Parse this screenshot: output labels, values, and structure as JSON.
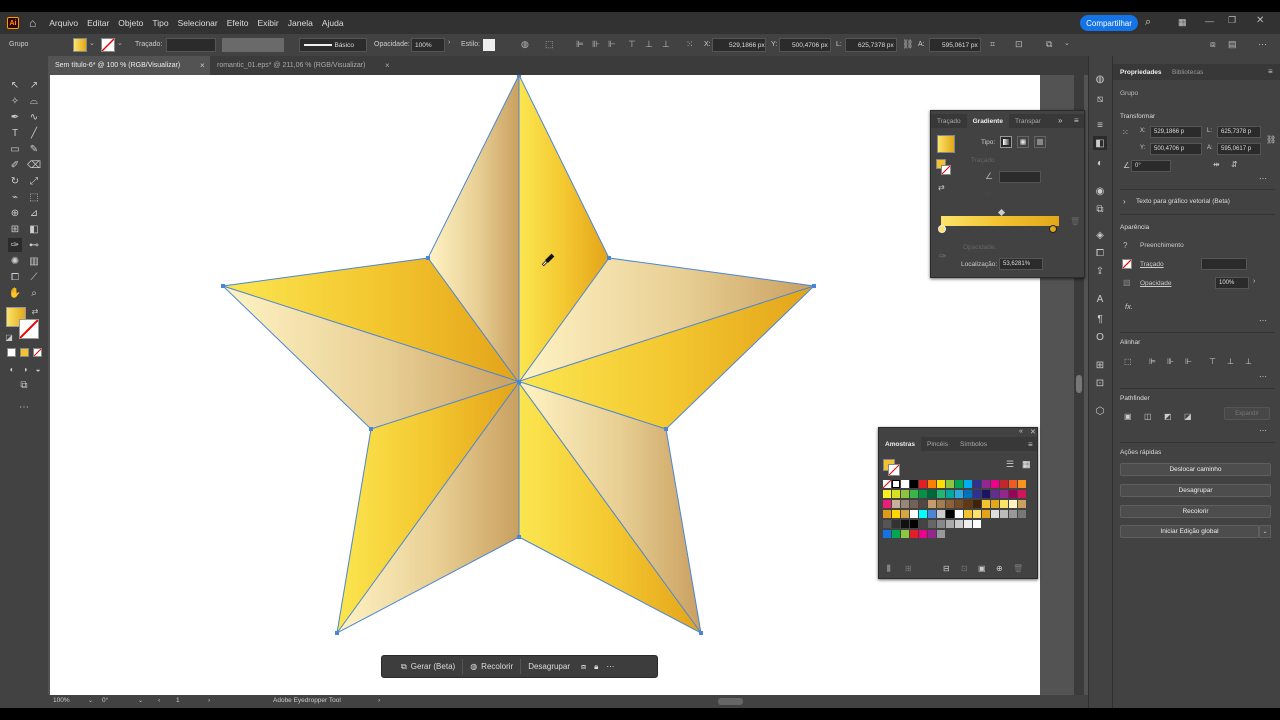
{
  "app": {
    "logo": "Ai",
    "share_label": "Compartilhar"
  },
  "menu": [
    "Arquivo",
    "Editar",
    "Objeto",
    "Tipo",
    "Selecionar",
    "Efeito",
    "Exibir",
    "Janela",
    "Ajuda"
  ],
  "control_bar": {
    "selection_type": "Grupo",
    "stroke_label": "Traçado:",
    "brush_value": "Básico",
    "opacity_label": "Opacidade:",
    "opacity_value": "100%",
    "style_label": "Estilo:",
    "x_label": "X:",
    "x_value": "529,1866 px",
    "y_label": "Y:",
    "y_value": "500,4706 px",
    "w_label": "L:",
    "w_value": "625,7378 px",
    "h_label": "A:",
    "h_value": "595,0617 px"
  },
  "tabs": [
    {
      "label": "Sem título-6* @ 100 % (RGB/Visualizar)",
      "active": true
    },
    {
      "label": "romantic_01.eps* @ 211,06 % (RGB/Visualizar)",
      "active": false
    }
  ],
  "gradient_panel": {
    "tabs": [
      "Traçado",
      "Gradiente",
      "Transpar"
    ],
    "type_label": "Tipo:",
    "stroke_label": "Traçado",
    "opacity_label": "Opacidade:",
    "location_label": "Localização:",
    "location_value": "53,6281%"
  },
  "swatches_panel": {
    "tabs": [
      "Amostras",
      "Pincéis",
      "Símbolos"
    ]
  },
  "context_bar": {
    "generate": "Gerar (Beta)",
    "recolor": "Recolorir",
    "ungroup": "Desagrupar"
  },
  "status_bar": {
    "zoom": "100%",
    "angle": "0°",
    "artboard": "1",
    "tool": "Adobe Eyedropper Tool"
  },
  "properties": {
    "tabs": [
      "Propriedades",
      "Bibliotecas"
    ],
    "group_label": "Grupo",
    "transform_label": "Transformar",
    "x_label": "X:",
    "x_value": "529,1866 p",
    "y_label": "Y:",
    "y_value": "500,4706 p",
    "w_label": "L:",
    "w_value": "625,7378 p",
    "h_label": "A:",
    "h_value": "595,0617 p",
    "angle_value": "0°",
    "vector_text": "Texto para gráfico vetorial (Beta)",
    "appearance_label": "Aparência",
    "fill_label": "Preenchimento",
    "stroke_label": "Traçado",
    "opacity_label": "Opacidade",
    "opacity_value": "100%",
    "fx_label": "fx.",
    "align_label": "Alinhar",
    "pathfinder_label": "Pathfinder",
    "expand_label": "Expandir",
    "quick_actions_label": "Ações rápidas",
    "quick_actions": [
      "Deslocar caminho",
      "Desagrupar",
      "Recolorir",
      "Iniciar Edição global"
    ]
  },
  "colors": {
    "accent": "#1473e6",
    "gold_light": "#fff3c4",
    "gold_mid": "#f2c230",
    "gold_dark": "#d99a12",
    "tan": "#c9a060"
  }
}
